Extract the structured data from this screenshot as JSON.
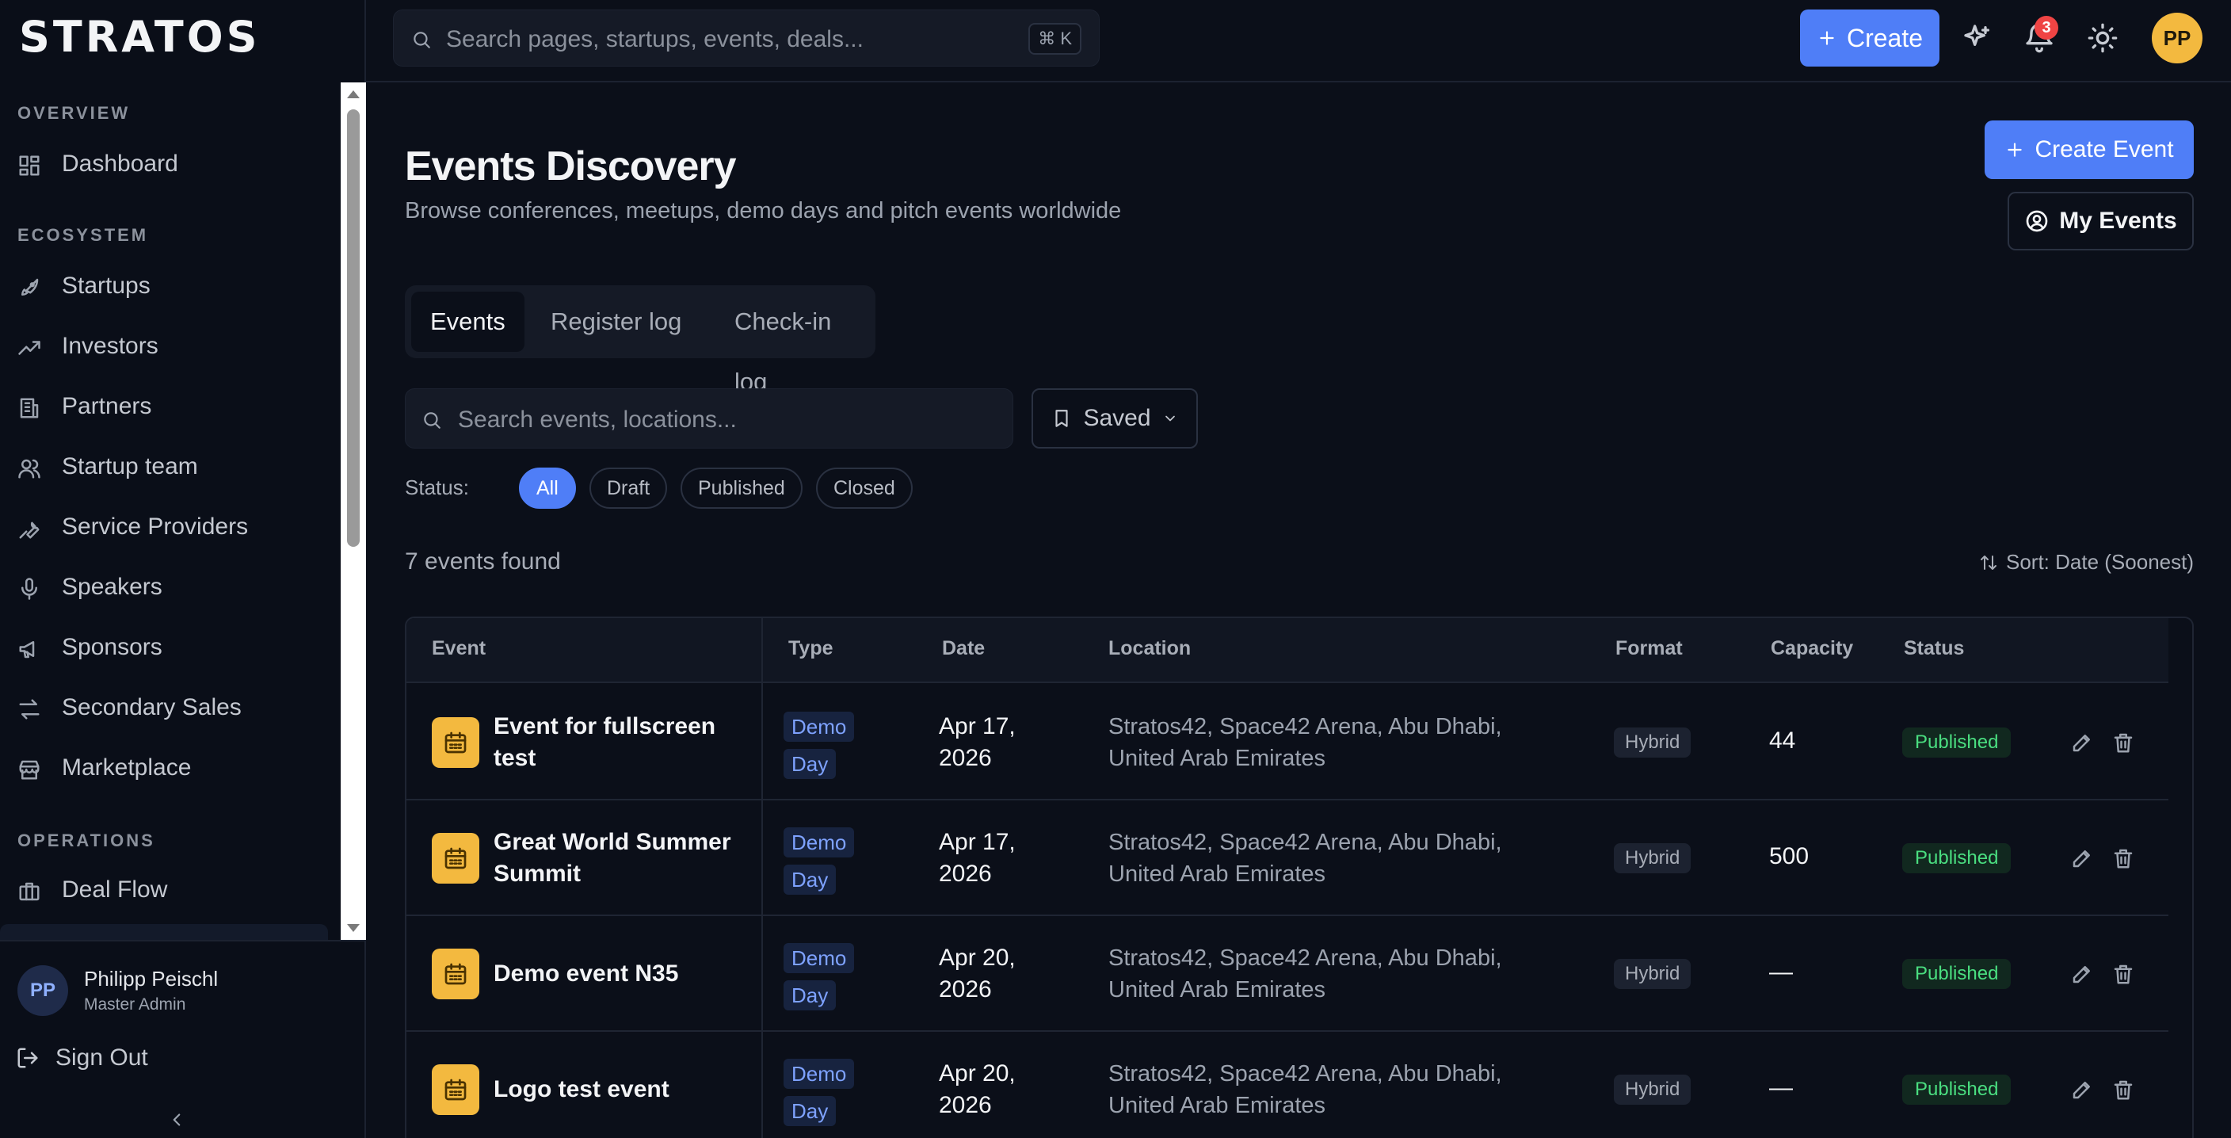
{
  "app": {
    "logo": "STRATOS"
  },
  "header": {
    "search_placeholder": "Search pages, startups, events, deals...",
    "shortcut": "⌘ K",
    "create_label": "Create",
    "notification_count": "3",
    "avatar_initials": "PP"
  },
  "sidebar": {
    "sections": [
      {
        "title": "OVERVIEW",
        "items": [
          {
            "label": "Dashboard",
            "icon": "dashboard-icon"
          }
        ]
      },
      {
        "title": "ECOSYSTEM",
        "items": [
          {
            "label": "Startups",
            "icon": "rocket-icon"
          },
          {
            "label": "Investors",
            "icon": "trending-up-icon"
          },
          {
            "label": "Partners",
            "icon": "building-icon"
          },
          {
            "label": "Startup team",
            "icon": "users-icon"
          },
          {
            "label": "Service Providers",
            "icon": "wrench-icon"
          },
          {
            "label": "Speakers",
            "icon": "microphone-icon"
          },
          {
            "label": "Sponsors",
            "icon": "megaphone-icon"
          },
          {
            "label": "Secondary Sales",
            "icon": "arrows-swap-icon"
          },
          {
            "label": "Marketplace",
            "icon": "store-icon"
          }
        ]
      },
      {
        "title": "OPERATIONS",
        "items": [
          {
            "label": "Deal Flow",
            "icon": "briefcase-icon"
          }
        ]
      }
    ],
    "user": {
      "initials": "PP",
      "name": "Philipp Peischl",
      "role": "Master Admin"
    },
    "sign_out": "Sign Out"
  },
  "main": {
    "title": "Events Discovery",
    "subtitle": "Browse conferences, meetups, demo days and pitch events worldwide",
    "create_event": "Create Event",
    "my_events": "My Events",
    "tabs": [
      {
        "label": "Events",
        "active": true
      },
      {
        "label": "Register log"
      },
      {
        "label": "Check-in log"
      }
    ],
    "search_placeholder": "Search events, locations...",
    "saved_label": "Saved",
    "status_label": "Status:",
    "status_filters": [
      {
        "label": "All",
        "active": true
      },
      {
        "label": "Draft"
      },
      {
        "label": "Published"
      },
      {
        "label": "Closed"
      }
    ],
    "count_text": "7 events found",
    "sort_text": "Sort: Date (Soonest)"
  },
  "table": {
    "columns": [
      "Event",
      "Type",
      "Date",
      "Location",
      "Format",
      "Capacity",
      "Status"
    ],
    "rows": [
      {
        "name_l1": "Event for fullscreen",
        "name_l2": "test",
        "type_l1": "Demo",
        "type_l2": "Day",
        "date_l1": "Apr 17,",
        "date_l2": "2026",
        "loc_l1": "Stratos42, Space42 Arena, Abu Dhabi,",
        "loc_l2": "United Arab Emirates",
        "format": "Hybrid",
        "capacity": "44",
        "status": "Published"
      },
      {
        "name_l1": "Great World Summer",
        "name_l2": "Summit",
        "type_l1": "Demo",
        "type_l2": "Day",
        "date_l1": "Apr 17,",
        "date_l2": "2026",
        "loc_l1": "Stratos42, Space42 Arena, Abu Dhabi,",
        "loc_l2": "United Arab Emirates",
        "format": "Hybrid",
        "capacity": "500",
        "status": "Published"
      },
      {
        "name_l1": "Demo event N35",
        "name_l2": "",
        "type_l1": "Demo",
        "type_l2": "Day",
        "date_l1": "Apr 20,",
        "date_l2": "2026",
        "loc_l1": "Stratos42, Space42 Arena, Abu Dhabi,",
        "loc_l2": "United Arab Emirates",
        "format": "Hybrid",
        "capacity": "—",
        "status": "Published"
      },
      {
        "name_l1": "Logo test event",
        "name_l2": "",
        "type_l1": "Demo",
        "type_l2": "Day",
        "date_l1": "Apr 20,",
        "date_l2": "2026",
        "loc_l1": "Stratos42, Space42 Arena, Abu Dhabi,",
        "loc_l2": "United Arab Emirates",
        "format": "Hybrid",
        "capacity": "—",
        "status": "Published"
      }
    ]
  }
}
